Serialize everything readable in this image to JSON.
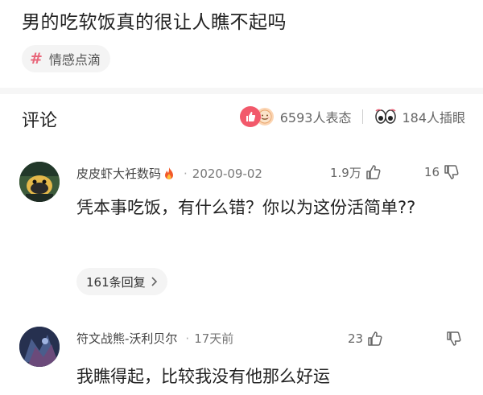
{
  "question": {
    "title": "男的吃软饭真的很让人瞧不起吗"
  },
  "topic": {
    "hash": "#",
    "label": "情感点滴"
  },
  "comments_header": {
    "title": "评论",
    "reactions_count": "6593人表态",
    "views_count": "184人插眼"
  },
  "comments": [
    {
      "author": "皮皮虾大衽数码",
      "dot": "·",
      "date": "2020-09-02",
      "likes": "1.9万",
      "dislikes": "16",
      "text": "凭本事吃饭，有什么错？你以为这份活简单??",
      "replies": "161条回复"
    },
    {
      "author": "符文战熊-沃利贝尔",
      "dot": "·",
      "date": "17天前",
      "likes": "23",
      "text": "我瞧得起，比较我没有他那么好运"
    }
  ],
  "colors": {
    "accent": "#f2596b",
    "topic_hash": "#e8667a"
  }
}
